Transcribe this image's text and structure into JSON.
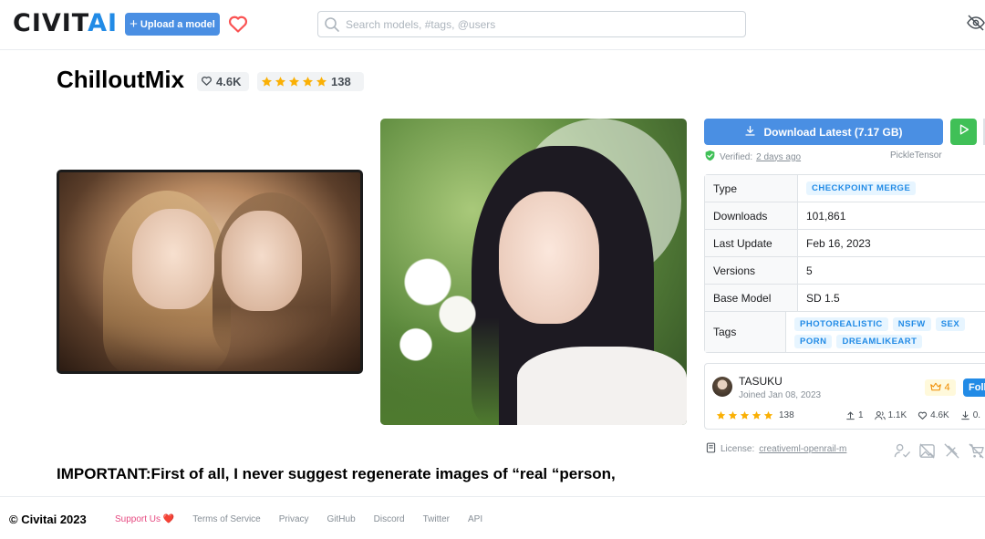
{
  "header": {
    "logo_main": "CIVIT",
    "logo_ai": "AI",
    "upload_label": "Upload a model",
    "search_placeholder": "Search models, #tags, @users"
  },
  "model": {
    "title": "ChilloutMix",
    "likes": "4.6K",
    "rating_count": "138",
    "rating": 5
  },
  "download": {
    "label": "Download Latest (7.17 GB)",
    "verified_prefix": "Verified:",
    "verified_when": "2 days ago",
    "uploader": "PickleTensor"
  },
  "details": {
    "type_label": "Type",
    "type_value": "CHECKPOINT MERGE",
    "downloads_label": "Downloads",
    "downloads_value": "101,861",
    "last_update_label": "Last Update",
    "last_update_value": "Feb 16, 2023",
    "versions_label": "Versions",
    "versions_value": "5",
    "base_model_label": "Base Model",
    "base_model_value": "SD 1.5",
    "tags_label": "Tags",
    "tags": [
      "PHOTOREALISTIC",
      "NSFW",
      "SEX",
      "PORN",
      "DREAMLIKEART"
    ]
  },
  "creator": {
    "name": "TASUKU",
    "joined": "Joined Jan 08, 2023",
    "crown_count": "4",
    "follow_label": "Foll",
    "rating_count": "138",
    "uploads": "1",
    "followers": "1.1K",
    "likes": "4.6K",
    "downloads": "0."
  },
  "license": {
    "prefix": "License:",
    "name": "creativeml-openrail-m"
  },
  "description_heading": "IMPORTANT:First of all, I never suggest regenerate images of “real “person,",
  "footer": {
    "copyright": "© Civitai 2023",
    "support": "Support Us ❤️",
    "terms": "Terms of Service",
    "privacy": "Privacy",
    "github": "GitHub",
    "discord": "Discord",
    "twitter": "Twitter",
    "api": "API"
  },
  "colors": {
    "primary": "#4a8fe3",
    "play": "#40c057",
    "star": "#fab005",
    "support": "#e64980"
  }
}
